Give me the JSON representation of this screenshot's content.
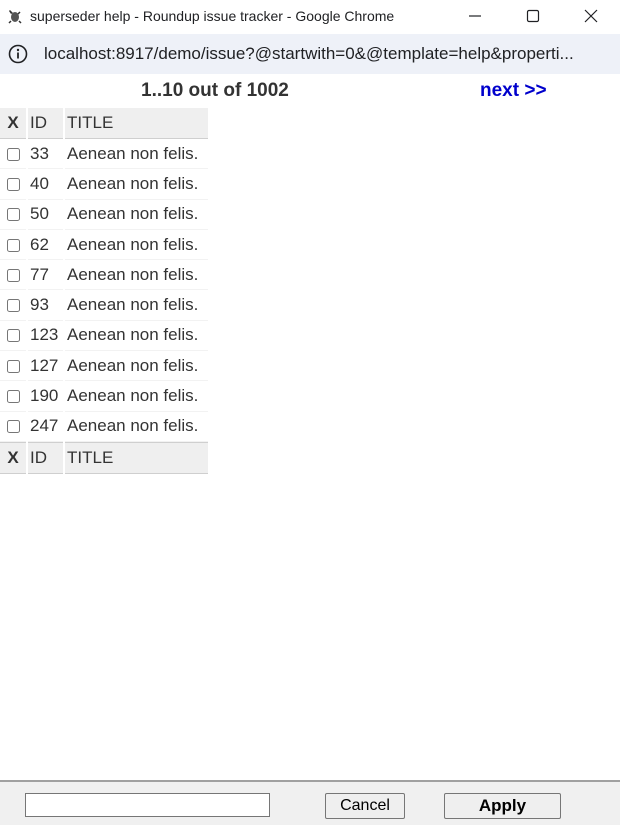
{
  "window": {
    "title": "superseder help - Roundup issue tracker - Google Chrome",
    "url": "localhost:8917/demo/issue?@startwith=0&@template=help&properti..."
  },
  "pager": {
    "count_text": "1..10 out of 1002",
    "next_label": "next >>"
  },
  "table": {
    "headers": {
      "x": "X",
      "id": "ID",
      "title": "TITLE"
    },
    "rows": [
      {
        "id": "33",
        "title": "Aenean non felis."
      },
      {
        "id": "40",
        "title": "Aenean non felis."
      },
      {
        "id": "50",
        "title": "Aenean non felis."
      },
      {
        "id": "62",
        "title": "Aenean non felis."
      },
      {
        "id": "77",
        "title": "Aenean non felis."
      },
      {
        "id": "93",
        "title": "Aenean non felis."
      },
      {
        "id": "123",
        "title": "Aenean non felis."
      },
      {
        "id": "127",
        "title": "Aenean non felis."
      },
      {
        "id": "190",
        "title": "Aenean non felis."
      },
      {
        "id": "247",
        "title": "Aenean non felis."
      }
    ]
  },
  "bottom": {
    "input_value": "",
    "cancel_label": "Cancel",
    "apply_label": "Apply"
  },
  "colors": {
    "link": "#0000cc",
    "header_bg": "#efefef",
    "omnibox_bg": "#eef1f8"
  },
  "icons": [
    "roundup-app-icon",
    "minimize-icon",
    "maximize-icon",
    "close-icon",
    "info-icon"
  ]
}
